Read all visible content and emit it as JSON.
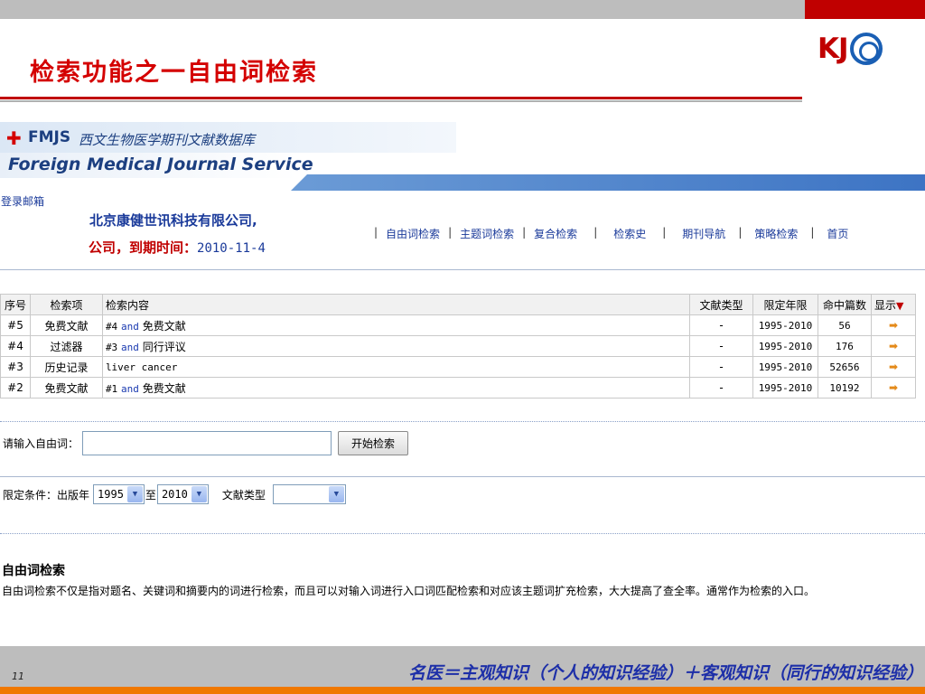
{
  "slide": {
    "title": "检索功能之一自由词检索",
    "logo_text": "KJ",
    "page_number": "11",
    "footer_quote": "名医＝主观知识（个人的知识经验）＋客观知识（同行的知识经验）"
  },
  "banner": {
    "brand_abbr": "FMJS",
    "brand_cn": "西文生物医学期刊文献数据库",
    "brand_en": "Foreign Medical Journal Service"
  },
  "header": {
    "login_link": "登录邮箱",
    "company": "北京康健世讯科技有限公司,",
    "company_line2_prefix": "公司，到期时间：",
    "expire_date": "2010-11-4"
  },
  "nav": {
    "items": [
      "自由词检索",
      "主题词检索",
      "复合检索",
      "检索史",
      "期刊导航",
      "策略检索",
      "首页"
    ]
  },
  "history": {
    "headers": {
      "seq": "序号",
      "item": "检索项",
      "content": "检索内容",
      "doc_type": "文献类型",
      "years": "限定年限",
      "hits": "命中篇数",
      "show": "显示"
    },
    "rows": [
      {
        "seq": "#5",
        "item": "免费文献",
        "ref": "#4",
        "op": "and",
        "term": "免费文献",
        "doc_type": "-",
        "years": "1995-2010",
        "hits": "56"
      },
      {
        "seq": "#4",
        "item": "过滤器",
        "ref": "#3",
        "op": "and",
        "term": "同行评议",
        "doc_type": "-",
        "years": "1995-2010",
        "hits": "176"
      },
      {
        "seq": "#3",
        "item": "历史记录",
        "ref": "",
        "op": "",
        "term": "liver cancer",
        "doc_type": "-",
        "years": "1995-2010",
        "hits": "52656"
      },
      {
        "seq": "#2",
        "item": "免费文献",
        "ref": "#1",
        "op": "and",
        "term": "免费文献",
        "doc_type": "-",
        "years": "1995-2010",
        "hits": "10192"
      }
    ]
  },
  "search": {
    "label": "请输入自由词：",
    "value": "",
    "button": "开始检索"
  },
  "limits": {
    "label": "限定条件：出版年",
    "year_from": "1995",
    "to_label": "至",
    "year_to": "2010",
    "doc_type_label": "文献类型",
    "doc_type_value": ""
  },
  "description": {
    "title": "自由词检索",
    "text": "自由词检索不仅是指对题名、关键词和摘要内的词进行检索，而且可以对输入词进行入口词匹配检索和对应该主题词扩充检索，大大提高了查全率。通常作为检索的入口。"
  },
  "colors": {
    "title_red": "#d40000",
    "link_blue": "#1a3a9a",
    "footer_orange": "#f07800",
    "quote_blue": "#1d2fa8"
  }
}
